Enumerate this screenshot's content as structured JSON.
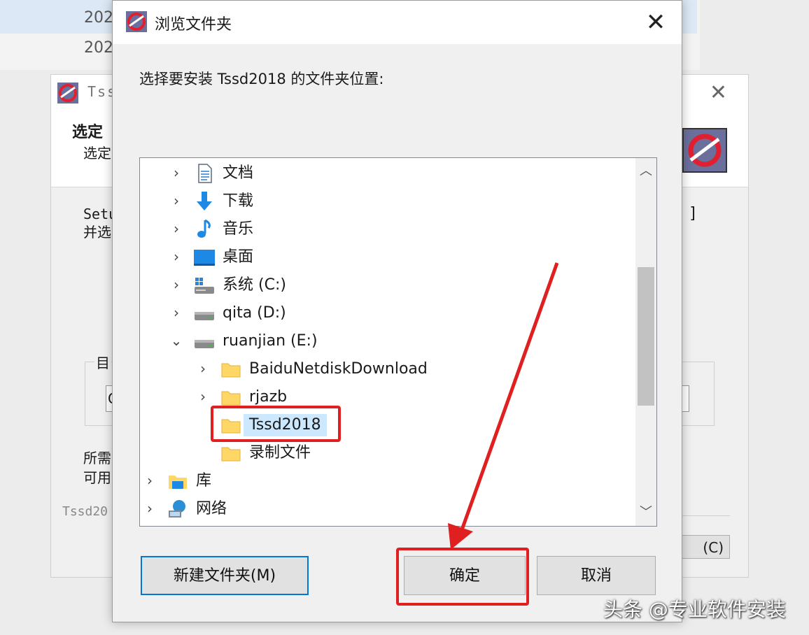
{
  "background": {
    "list_rows": [
      "202",
      "202"
    ]
  },
  "setup_window": {
    "title": "Tss",
    "heading": "选定",
    "subheading": "选定",
    "body_lines": [
      "Setu",
      "并选"
    ],
    "bracket": "]",
    "group_label": "目",
    "input_value": "C",
    "space_lines": [
      "所需",
      "可用"
    ],
    "footer": "Tssd20",
    "cancel_label": "(C)"
  },
  "dialog": {
    "title": "浏览文件夹",
    "prompt": "选择要安装 Tssd2018 的文件夹位置:",
    "tree": [
      {
        "label": "文档",
        "icon": "document-icon",
        "expanded": false
      },
      {
        "label": "下载",
        "icon": "download-arrow-icon",
        "expanded": false
      },
      {
        "label": "音乐",
        "icon": "music-note-icon",
        "expanded": false
      },
      {
        "label": "桌面",
        "icon": "desktop-icon",
        "expanded": false
      },
      {
        "label": "系统 (C:)",
        "icon": "system-drive-icon",
        "expanded": false
      },
      {
        "label": "qita (D:)",
        "icon": "drive-icon",
        "expanded": false
      },
      {
        "label": "ruanjian (E:)",
        "icon": "drive-icon",
        "expanded": true
      },
      {
        "label": "BaiduNetdiskDownload",
        "icon": "folder-icon",
        "expanded": false
      },
      {
        "label": "rjazb",
        "icon": "folder-icon",
        "expanded": false
      },
      {
        "label": "Tssd2018",
        "icon": "folder-icon",
        "selected": true
      },
      {
        "label": "录制文件",
        "icon": "folder-icon"
      },
      {
        "label": "库",
        "icon": "library-icon",
        "expanded": false
      },
      {
        "label": "网络",
        "icon": "network-icon",
        "expanded": false
      }
    ],
    "buttons": {
      "new_folder": "新建文件夹(M)",
      "ok": "确定",
      "cancel": "取消"
    }
  },
  "colors": {
    "highlight": "#e02020",
    "selection": "#cce8ff",
    "focus_border": "#0078d7"
  },
  "watermark": "头条 @专业软件安装"
}
